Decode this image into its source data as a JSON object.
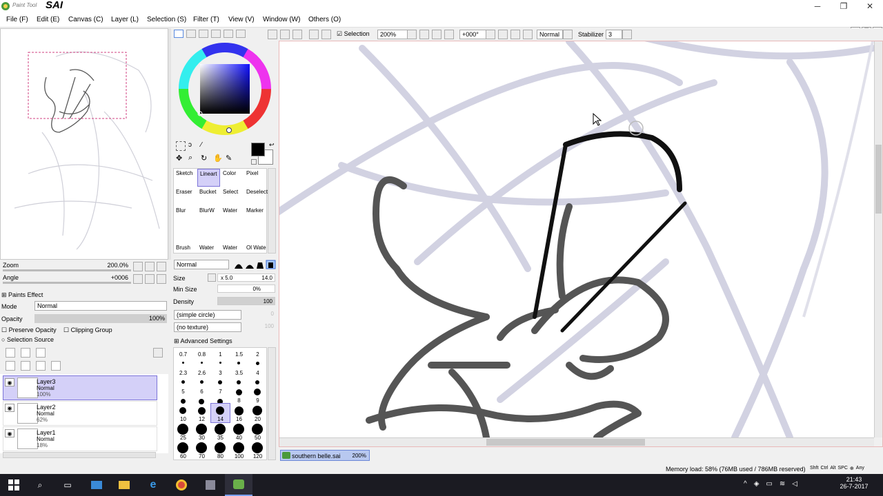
{
  "app": {
    "logo_text": "Paint Tool",
    "name": "SAI",
    "window_buttons": [
      "─",
      "❐",
      "✕"
    ]
  },
  "menu": [
    "File (F)",
    "Edit (E)",
    "Canvas (C)",
    "Layer (L)",
    "Selection (S)",
    "Filter (T)",
    "View (V)",
    "Window (W)",
    "Others (O)"
  ],
  "navigator": {
    "zoom_label": "Zoom",
    "zoom_value": "200.0%",
    "angle_label": "Angle",
    "angle_value": "+0006"
  },
  "layer_props": {
    "paints_effect": "Paints Effect",
    "mode_label": "Mode",
    "mode_value": "Normal",
    "opacity_label": "Opacity",
    "opacity_value": "100%",
    "preserve_opacity": "Preserve Opacity",
    "clipping_group": "Clipping Group",
    "selection_source": "Selection Source"
  },
  "layers": [
    {
      "name": "Layer3",
      "mode": "Normal",
      "opacity": "100%",
      "selected": true
    },
    {
      "name": "Layer2",
      "mode": "Normal",
      "opacity": "62%",
      "selected": false
    },
    {
      "name": "Layer1",
      "mode": "Normal",
      "opacity": "18%",
      "selected": false
    }
  ],
  "tools": [
    {
      "label": "Sketch",
      "selected": false
    },
    {
      "label": "Lineart",
      "selected": true
    },
    {
      "label": "Color",
      "selected": false
    },
    {
      "label": "Pixel",
      "selected": false
    },
    {
      "label": "Eraser",
      "selected": false
    },
    {
      "label": "Bucket",
      "selected": false
    },
    {
      "label": "Select",
      "selected": false
    },
    {
      "label": "Deselect",
      "selected": false
    },
    {
      "label": "Blur",
      "selected": false
    },
    {
      "label": "BlurW",
      "selected": false
    },
    {
      "label": "Water",
      "selected": false
    },
    {
      "label": "Marker",
      "selected": false
    },
    {
      "label": "Brush",
      "selected": false
    },
    {
      "label": "Water",
      "selected": false
    },
    {
      "label": "Water",
      "selected": false
    },
    {
      "label": "Ol Wate",
      "selected": false
    }
  ],
  "brush": {
    "blend_mode": "Normal",
    "size_label": "Size",
    "size_multiplier": "x 5.0",
    "size_value": "14.0",
    "min_size_label": "Min Size",
    "min_size_value": "0%",
    "density_label": "Density",
    "density_value": "100",
    "shape": "(simple circle)",
    "shape_value": "0",
    "texture": "(no texture)",
    "texture_value": "100",
    "advanced": "Advanced Settings"
  },
  "brush_sizes": [
    "0.7",
    "0.8",
    "1",
    "1.5",
    "2",
    "2.3",
    "2.6",
    "3",
    "3.5",
    "4",
    "5",
    "6",
    "7",
    "8",
    "9",
    "10",
    "12",
    "14",
    "16",
    "20",
    "25",
    "30",
    "35",
    "40",
    "50",
    "60",
    "70",
    "80",
    "100",
    "120"
  ],
  "brush_size_selected": "14",
  "canvas_toolbar": {
    "selection_label": "Selection",
    "zoom": "200%",
    "angle": "+000°",
    "mode": "Normal",
    "stabilizer_label": "Stabilizer",
    "stabilizer_value": "3"
  },
  "document_tab": {
    "name": "southern belle.sai",
    "zoom": "200%"
  },
  "status": {
    "memory": "Memory load: 58% (76MB used / 786MB reserved)",
    "keys": [
      "Shft",
      "Ctrl",
      "Alt",
      "SPC",
      "Any"
    ]
  },
  "taskbar": {
    "time": "21:43",
    "date": "26-7-2017"
  },
  "colors": {
    "accent_selection": "#d4d0f8",
    "taskbar": "#1b1b22"
  }
}
